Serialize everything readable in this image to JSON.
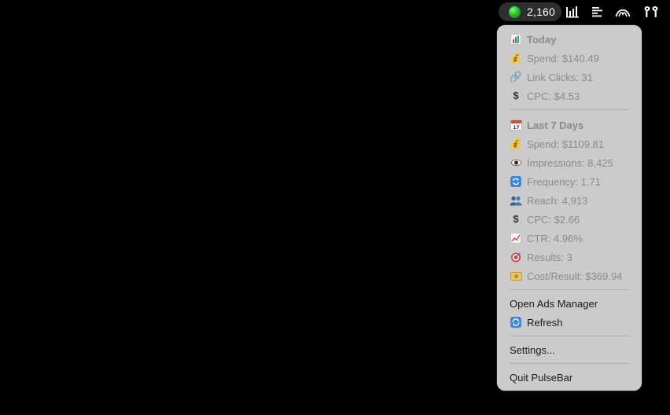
{
  "menubar": {
    "status_value": "2,160",
    "status_color": "#22c522",
    "icons": [
      "bars-chart-icon",
      "text-lines-icon",
      "arc-wave-icon",
      "airpods-icon"
    ]
  },
  "menu": {
    "today": {
      "header": "Today",
      "header_icon": "bar-chart-emoji-icon",
      "items": [
        {
          "icon": "money-bag-icon",
          "label": "Spend: $140.49"
        },
        {
          "icon": "link-icon",
          "label": "Link Clicks: 31"
        },
        {
          "icon": "dollar-sign-icon",
          "label": "CPC: $4.53"
        }
      ]
    },
    "last7": {
      "header": "Last 7 Days",
      "header_icon": "calendar-icon",
      "items": [
        {
          "icon": "money-bag-icon",
          "label": "Spend: $1109.81"
        },
        {
          "icon": "eye-icon",
          "label": "Impressions: 8,425"
        },
        {
          "icon": "repeat-icon",
          "label": "Frequency: 1.71"
        },
        {
          "icon": "people-icon",
          "label": "Reach: 4,913"
        },
        {
          "icon": "dollar-sign-icon",
          "label": "CPC: $2.66"
        },
        {
          "icon": "trend-chart-icon",
          "label": "CTR: 4.96%"
        },
        {
          "icon": "target-icon",
          "label": "Results: 3"
        },
        {
          "icon": "money-bill-icon",
          "label": "Cost/Result: $369.94"
        }
      ]
    },
    "actions": {
      "open_ads_manager": "Open Ads Manager",
      "refresh": "Refresh",
      "refresh_icon": "refresh-icon",
      "settings": "Settings...",
      "quit": "Quit PulseBar"
    }
  }
}
